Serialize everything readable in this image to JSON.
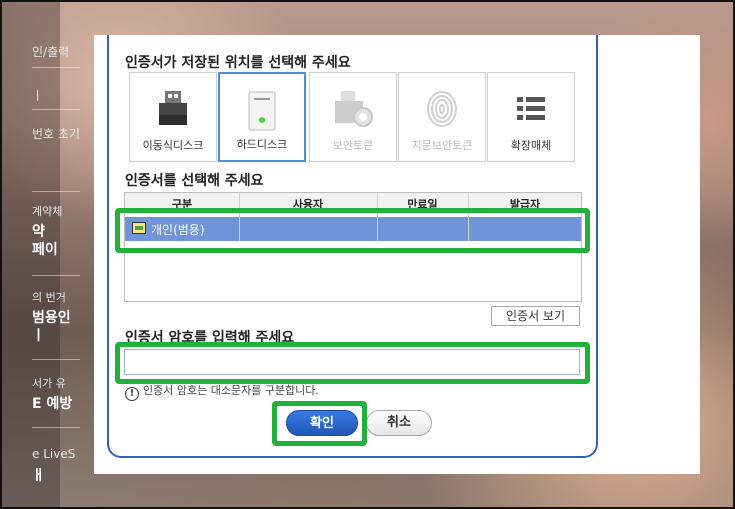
{
  "sidebar": {
    "items": [
      "인/출력",
      "ㅣ",
      "번호 초기",
      "계약체",
      "약",
      "페이",
      "의 번거",
      "범용인",
      "ㅣ",
      "서가 유",
      "E 예방",
      "e LiveS",
      "ㅐ"
    ]
  },
  "dialog": {
    "storage_title": "인증서가 저장된 위치를 선택해 주세요",
    "storage_options": [
      {
        "label": "이동식디스크",
        "icon": "usb-drive-icon",
        "state": "enabled"
      },
      {
        "label": "하드디스크",
        "icon": "hard-disk-icon",
        "state": "selected"
      },
      {
        "label": "보안토큰",
        "icon": "security-token-icon",
        "state": "disabled"
      },
      {
        "label": "지문보안토큰",
        "icon": "fingerprint-icon",
        "state": "disabled"
      },
      {
        "label": "확장매체",
        "icon": "list-icon",
        "state": "enabled"
      }
    ],
    "cert_title": "인증서를 선택해 주세요",
    "table": {
      "headers": [
        "구분",
        "사용자",
        "만료일",
        "발급자"
      ],
      "rows": [
        {
          "type": "개인(범용)",
          "user": "",
          "expiry": "",
          "issuer": ""
        }
      ]
    },
    "view_cert_button": "인증서 보기",
    "password_title": "인증서 암호를 입력해 주세요",
    "password_value": "",
    "note": "인증서 암호는 대소문자를 구분합니다.",
    "ok_button": "확인",
    "cancel_button": "취소"
  },
  "colors": {
    "highlight": "#1fb13a",
    "selected_row": "#6f95d8",
    "dialog_border": "#2f62b8",
    "ok_button": "#2a66cc"
  }
}
